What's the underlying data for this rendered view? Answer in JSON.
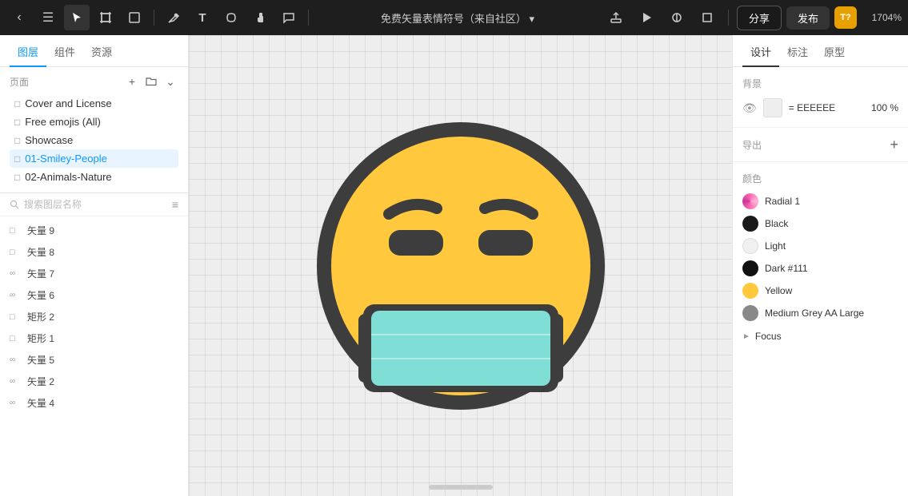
{
  "toolbar": {
    "title": "免费矢量表情符号（来自社区）",
    "title_suffix": "▾",
    "share_label": "分享",
    "publish_label": "发布",
    "user_initials": "T?",
    "zoom_label": "1704%"
  },
  "left_sidebar": {
    "tabs": [
      {
        "id": "layers",
        "label": "图层"
      },
      {
        "id": "components",
        "label": "组件"
      },
      {
        "id": "assets",
        "label": "资源"
      }
    ],
    "active_tab": "layers",
    "pages_title": "页面",
    "pages": [
      {
        "id": "cover",
        "label": "Cover and License"
      },
      {
        "id": "free-emojis",
        "label": "Free emojis (All)"
      },
      {
        "id": "showcase",
        "label": "Showcase"
      },
      {
        "id": "01-smiley",
        "label": "01-Smiley-People",
        "active": true
      },
      {
        "id": "02-animals",
        "label": "02-Animals-Nature"
      }
    ],
    "search_placeholder": "搜索图层名称",
    "layers": [
      {
        "id": "vector9",
        "label": "矢量 9",
        "type": "vector"
      },
      {
        "id": "vector8",
        "label": "矢量 8",
        "type": "vector"
      },
      {
        "id": "vector7",
        "label": "矢量 7",
        "type": "link"
      },
      {
        "id": "vector6",
        "label": "矢量 6",
        "type": "link"
      },
      {
        "id": "rect2",
        "label": "矩形 2",
        "type": "rect"
      },
      {
        "id": "rect1",
        "label": "矩形 1",
        "type": "rect"
      },
      {
        "id": "vector5",
        "label": "矢量 5",
        "type": "link"
      },
      {
        "id": "vector2",
        "label": "矢量 2",
        "type": "link"
      },
      {
        "id": "vector4",
        "label": "矢量 4",
        "type": "link"
      }
    ]
  },
  "right_sidebar": {
    "tabs": [
      {
        "id": "design",
        "label": "设计",
        "active": true
      },
      {
        "id": "mark",
        "label": "标注"
      },
      {
        "id": "prototype",
        "label": "原型"
      }
    ],
    "background_section_title": "背景",
    "bg_color": "EEEEEE",
    "bg_opacity": "100 %",
    "export_section_title": "导出",
    "colors_section_title": "颜色",
    "colors": [
      {
        "id": "radial1",
        "label": "Radial 1",
        "type": "radial"
      },
      {
        "id": "black",
        "label": "Black",
        "type": "black"
      },
      {
        "id": "light",
        "label": "Light",
        "type": "light"
      },
      {
        "id": "dark111",
        "label": "Dark #111",
        "type": "dark"
      },
      {
        "id": "yellow",
        "label": "Yellow",
        "type": "yellow"
      },
      {
        "id": "medium-grey",
        "label": "Medium Grey AA Large",
        "type": "medium-grey"
      }
    ],
    "focus_label": "Focus"
  }
}
